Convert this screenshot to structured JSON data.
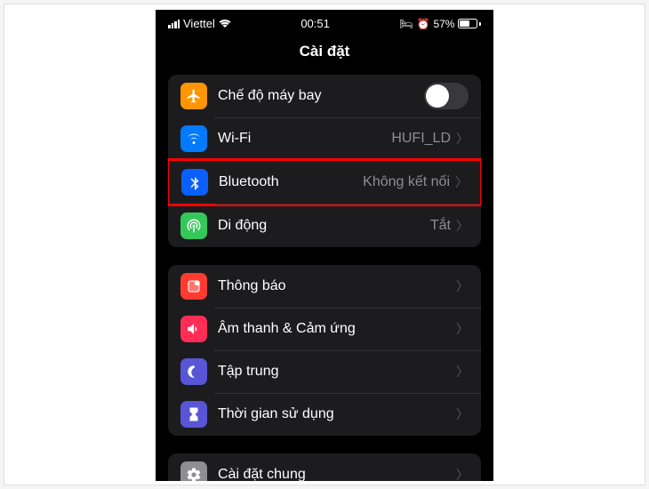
{
  "status": {
    "carrier": "Viettel",
    "time": "00:51",
    "batteryText": "57%"
  },
  "header": {
    "title": "Cài đặt"
  },
  "group1": {
    "airplane": {
      "label": "Chế độ máy bay"
    },
    "wifi": {
      "label": "Wi-Fi",
      "value": "HUFI_LD"
    },
    "bluetooth": {
      "label": "Bluetooth",
      "value": "Không kết nối"
    },
    "cellular": {
      "label": "Di động",
      "value": "Tắt"
    }
  },
  "group2": {
    "notifications": {
      "label": "Thông báo"
    },
    "sounds": {
      "label": "Âm thanh & Cảm ứng"
    },
    "focus": {
      "label": "Tập trung"
    },
    "screentime": {
      "label": "Thời gian sử dụng"
    }
  },
  "group3": {
    "general": {
      "label": "Cài đặt chung"
    }
  }
}
